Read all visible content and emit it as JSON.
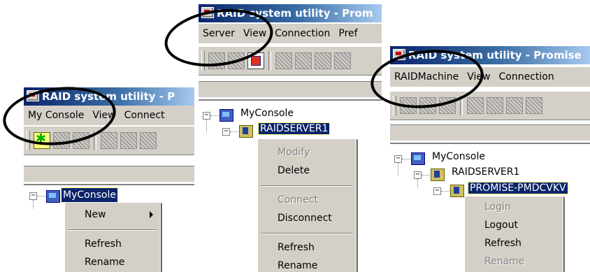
{
  "panels": [
    {
      "title": "RAID system utility - P",
      "menu": [
        "My Console",
        "View",
        "Connect"
      ],
      "tree": {
        "root": "MyConsole"
      },
      "context_menu": {
        "items": [
          {
            "label": "New",
            "enabled": true,
            "submenu": true
          },
          {
            "label": "Refresh",
            "enabled": true
          },
          {
            "label": "Rename",
            "enabled": true
          }
        ]
      }
    },
    {
      "title": "RAID system utility - Prom",
      "menu": [
        "Server",
        "View",
        "Connection",
        "Pref"
      ],
      "tree": {
        "root": "MyConsole",
        "child": "RAIDSERVER1"
      },
      "context_menu": {
        "items": [
          {
            "label": "Modify",
            "enabled": false
          },
          {
            "label": "Delete",
            "enabled": true
          },
          {
            "label": "Connect",
            "enabled": false
          },
          {
            "label": "Disconnect",
            "enabled": true
          },
          {
            "label": "Refresh",
            "enabled": true
          },
          {
            "label": "Rename",
            "enabled": true
          }
        ]
      }
    },
    {
      "title": "RAID system utility - Promise",
      "menu": [
        "RAIDMachine",
        "View",
        "Connection"
      ],
      "tree": {
        "root": "MyConsole",
        "child": "RAIDSERVER1",
        "grandchild": "PROMISE-PMDCVKV"
      },
      "context_menu": {
        "items": [
          {
            "label": "Login",
            "enabled": false
          },
          {
            "label": "Logout",
            "enabled": true
          },
          {
            "label": "Refresh",
            "enabled": true
          },
          {
            "label": "Rename",
            "enabled": false
          }
        ]
      }
    }
  ],
  "colors": {
    "titlebar": "#0a246a",
    "face": "#d4d0c8",
    "selection": "#0a246a",
    "disabled": "#808080"
  }
}
